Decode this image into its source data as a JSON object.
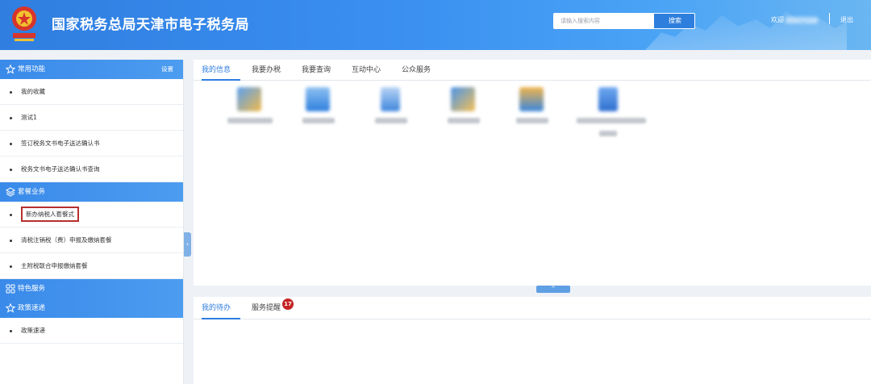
{
  "header": {
    "title": "国家税务总局天津市电子税务局",
    "search_placeholder": "请输入搜索内容",
    "search_button": "搜索",
    "welcome": "欢迎",
    "logout": "退出"
  },
  "sidebar": {
    "sections": [
      {
        "title": "常用功能",
        "icon": "star-icon",
        "action": "设置",
        "items": [
          "我的收藏",
          "测试1",
          "签订税务文书电子送达确认书",
          "税务文书电子送达确认书查询"
        ]
      },
      {
        "title": "套餐业务",
        "icon": "layers-icon",
        "items": [
          "新办纳税人套餐式",
          "清税注销税（费）申报及缴纳套餐",
          "主附税联合申报缴纳套餐"
        ]
      },
      {
        "title": "特色服务",
        "icon": "grid-icon",
        "items": []
      },
      {
        "title": "政策速递",
        "icon": "star-icon",
        "items": [
          "政策速递"
        ]
      }
    ]
  },
  "main": {
    "tabs": [
      "我的信息",
      "我要办税",
      "我要查询",
      "互动中心",
      "公众服务"
    ],
    "active_tab": 0
  },
  "bottom": {
    "tabs": [
      "我的待办",
      "服务提醒"
    ],
    "badge_count": "17"
  },
  "colors": {
    "primary": "#2f7ee0",
    "highlight_border": "#b5302f",
    "badge": "#c52323"
  }
}
